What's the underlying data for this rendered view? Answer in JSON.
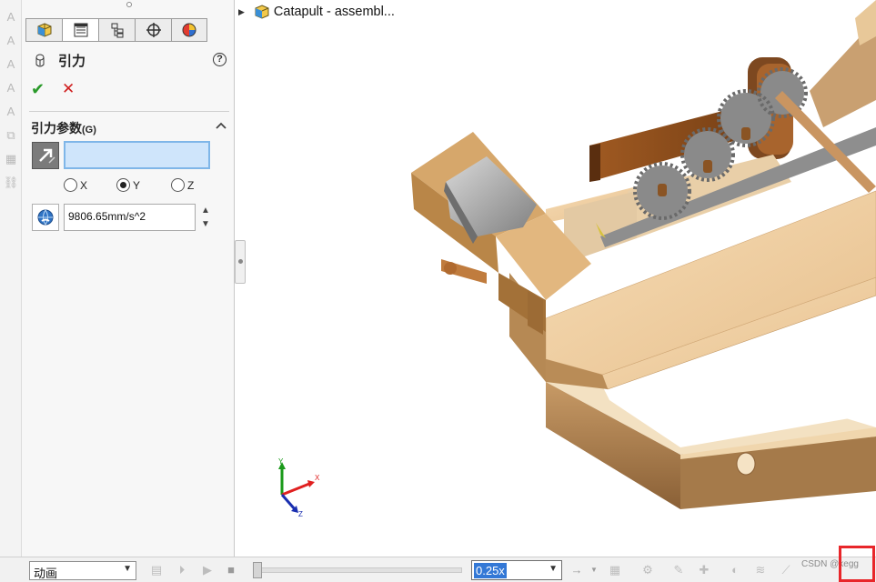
{
  "panel": {
    "title": "引力",
    "group_title": "引力参数",
    "group_shortcut": "(G)",
    "axes": [
      "X",
      "Y",
      "Z"
    ],
    "selected_axis": "Y",
    "direction_selection": "",
    "gravity_value": "9806.65mm/s^2"
  },
  "tree": {
    "root_label": "Catapult - assembl..."
  },
  "triad": {
    "x": "X",
    "y": "Y",
    "z": "Z"
  },
  "bottombar": {
    "study_type": "动画",
    "playback_speed": "0.25x"
  },
  "watermark": "CSDN @kegg",
  "colors": {
    "accent": "#3378d6",
    "highlight_border": "#e8262a",
    "ok": "#2a9a2a",
    "cancel": "#d02020",
    "selection_box": "#cfe5fb"
  }
}
